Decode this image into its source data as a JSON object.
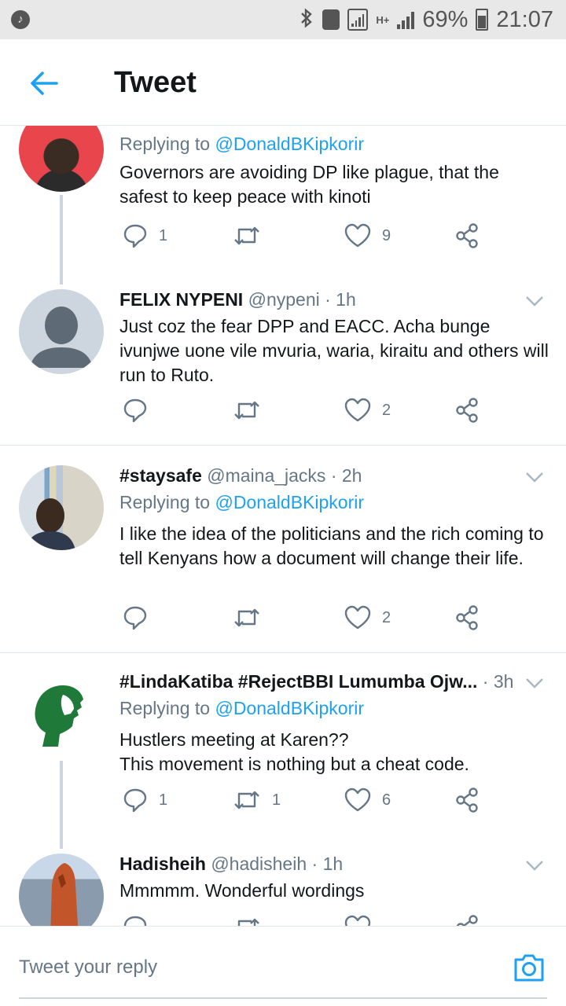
{
  "status_bar": {
    "battery": "69%",
    "time": "21:07",
    "network": "H+"
  },
  "header": {
    "title": "Tweet"
  },
  "tweets": [
    {
      "replying_prefix": "Replying to ",
      "replying_to": "@DonaldBKipkorir",
      "text": "Governors are avoiding DP like plague, that the safest to keep peace with kinoti",
      "reply_count": "1",
      "retweet_count": "",
      "like_count": "9"
    },
    {
      "name": "FELIX NYPENI",
      "handle": "@nypeni",
      "time": "· 1h",
      "text": "Just coz the fear DPP and EACC. Acha bunge ivunjwe uone vile mvuria, waria, kiraitu and others will run to Ruto.",
      "reply_count": "",
      "retweet_count": "",
      "like_count": "2"
    },
    {
      "name": "#staysafe",
      "handle": "@maina_jacks",
      "time": "· 2h",
      "replying_prefix": "Replying to ",
      "replying_to": "@DonaldBKipkorir",
      "text": "I like the idea of the politicians and the rich coming to tell Kenyans how a document will change their life.",
      "reply_count": "",
      "retweet_count": "",
      "like_count": "2"
    },
    {
      "name": "#LindaKatiba #RejectBBI Lumumba Ojw...",
      "handle": "",
      "time": "· 3h",
      "replying_prefix": "Replying to ",
      "replying_to": "@DonaldBKipkorir",
      "text_line1": "Hustlers meeting at Karen??",
      "text_line2": "This movement is nothing but a cheat code.",
      "reply_count": "1",
      "retweet_count": "1",
      "like_count": "6"
    },
    {
      "name": "Hadisheih",
      "handle": "@hadisheih",
      "time": "· 1h",
      "text": "Mmmmm. Wonderful wordings"
    }
  ],
  "reply_bar": {
    "placeholder": "Tweet your reply"
  },
  "colors": {
    "accent": "#1da1f2",
    "secondary_text": "#657786",
    "divider": "#e1e8ed"
  },
  "icons": [
    "music-icon",
    "bluetooth-icon",
    "phone-icon",
    "sim-signal-icon",
    "signal-icon",
    "battery-icon",
    "back-arrow-icon",
    "reply-icon",
    "retweet-icon",
    "like-icon",
    "share-icon",
    "chevron-down-icon",
    "camera-icon"
  ]
}
